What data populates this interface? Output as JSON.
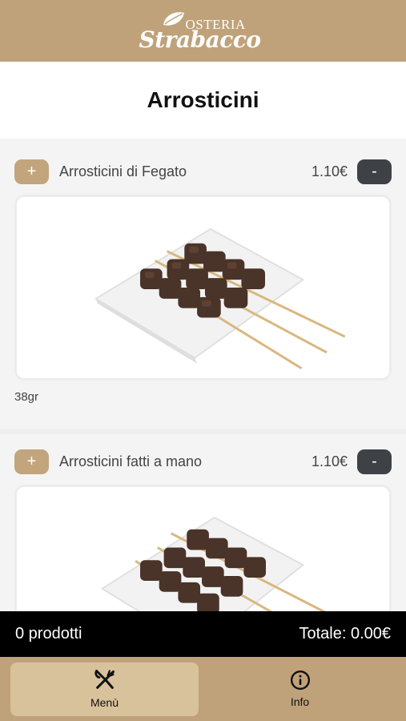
{
  "header": {
    "logo_top": "OSTERIA",
    "logo_main": "Strabacco"
  },
  "page_title": "Arrosticini",
  "products": [
    {
      "name": "Arrosticini di Fegato",
      "price": "1.10€",
      "weight": "38gr",
      "add_label": "+",
      "remove_label": "-"
    },
    {
      "name": "Arrosticini fatti a mano",
      "price": "1.10€",
      "add_label": "+",
      "remove_label": "-"
    }
  ],
  "cart": {
    "count_text": "0 prodotti",
    "total_text": "Totale: 0.00€"
  },
  "nav": {
    "items": [
      {
        "label": "Menù",
        "icon": "cutlery-icon",
        "active": true
      },
      {
        "label": "Info",
        "icon": "info-icon",
        "active": false
      }
    ]
  },
  "colors": {
    "brand": "#bfa27a",
    "button_add": "#c2a57d",
    "button_remove": "#3e4247",
    "cart_bar": "#000000"
  }
}
